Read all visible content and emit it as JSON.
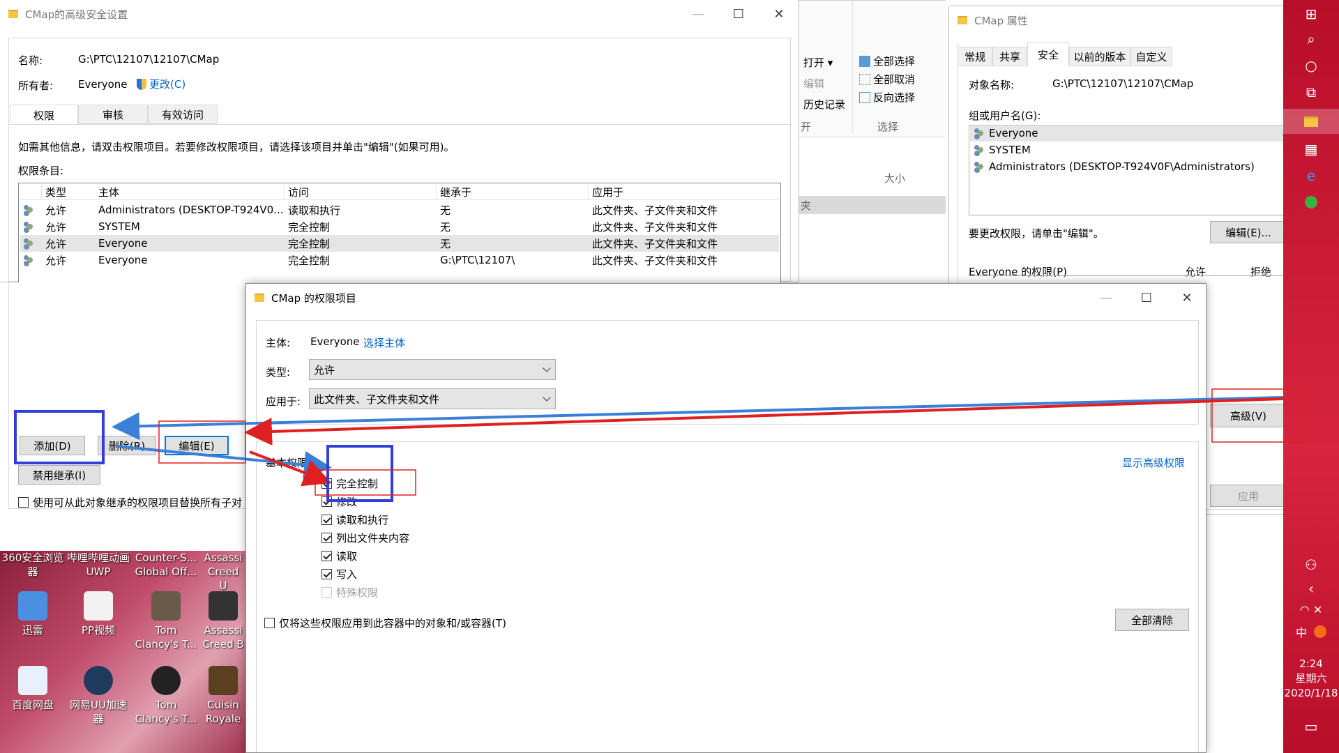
{
  "adv_window": {
    "title": "CMap的高级安全设置",
    "name_label": "名称:",
    "name_value": "G:\\PTC\\12107\\12107\\CMap",
    "owner_label": "所有者:",
    "owner_value": "Everyone",
    "change_link": "更改(C)",
    "tabs": [
      "权限",
      "审核",
      "有效访问"
    ],
    "info_text": "如需其他信息，请双击权限项目。若要修改权限项目，请选择该项目并单击\"编辑\"(如果可用)。",
    "entries_label": "权限条目:",
    "columns": [
      "类型",
      "主体",
      "访问",
      "继承于",
      "应用于"
    ],
    "rows": [
      [
        "允许",
        "Administrators (DESKTOP-T924V0...",
        "读取和执行",
        "无",
        "此文件夹、子文件夹和文件"
      ],
      [
        "允许",
        "SYSTEM",
        "完全控制",
        "无",
        "此文件夹、子文件夹和文件"
      ],
      [
        "允许",
        "Everyone",
        "完全控制",
        "无",
        "此文件夹、子文件夹和文件"
      ],
      [
        "允许",
        "Everyone",
        "完全控制",
        "G:\\PTC\\12107\\",
        "此文件夹、子文件夹和文件"
      ]
    ],
    "add_button": "添加(D)",
    "remove_button": "删除(R)",
    "edit_button": "编辑(E)",
    "disable_inherit_button": "禁用继承(I)",
    "replace_checkbox": "使用可从此对象继承的权限项目替换所有子对"
  },
  "explorer": {
    "open": "打开",
    "edit": "编辑",
    "history": "历史记录",
    "open_group": "开",
    "select_all": "全部选择",
    "select_none": "全部取消",
    "invert": "反向选择",
    "select_group": "选择",
    "size_col": "大小",
    "row_fragment": "夹"
  },
  "props_window": {
    "title": "CMap 属性",
    "tabs": [
      "常规",
      "共享",
      "安全",
      "以前的版本",
      "自定义"
    ],
    "object_label": "对象名称:",
    "object_value": "G:\\PTC\\12107\\12107\\CMap",
    "group_label": "组或用户名(G):",
    "users": [
      "Everyone",
      "SYSTEM",
      "Administrators (DESKTOP-T924V0F\\Administrators)"
    ],
    "change_hint": "要更改权限，请单击\"编辑\"。",
    "edit_button": "编辑(E)...",
    "perm_for": "Everyone 的权限(P)",
    "allow": "允许",
    "deny": "拒绝",
    "advanced_button": "高级(V)",
    "apply_button": "应用"
  },
  "entry_window": {
    "title": "CMap 的权限项目",
    "principal_label": "主体:",
    "principal_value": "Everyone",
    "select_principal": "选择主体",
    "type_label": "类型:",
    "type_value": "允许",
    "applies_label": "应用于:",
    "applies_value": "此文件夹、子文件夹和文件",
    "basic_label": "基本权限:",
    "show_advanced": "显示高级权限",
    "perms": [
      {
        "label": "完全控制",
        "checked": true,
        "disabled": false
      },
      {
        "label": "修改",
        "checked": true,
        "disabled": false
      },
      {
        "label": "读取和执行",
        "checked": true,
        "disabled": false
      },
      {
        "label": "列出文件夹内容",
        "checked": true,
        "disabled": false
      },
      {
        "label": "读取",
        "checked": true,
        "disabled": false
      },
      {
        "label": "写入",
        "checked": true,
        "disabled": false
      },
      {
        "label": "特殊权限",
        "checked": false,
        "disabled": true
      }
    ],
    "only_apply": "仅将这些权限应用到此容器中的对象和/或容器(T)",
    "clear_all": "全部清除"
  },
  "desktop": {
    "top_labels": [
      "360安全浏览器",
      "哔哩哔哩动画 UWP",
      "Counter-S... Global Off...",
      "Assassi Creed U"
    ],
    "icons_row1": [
      "迅雷",
      "PP视频",
      "Tom Clancy's T...",
      "Assassi Creed B"
    ],
    "icons_row2": [
      "百度网盘",
      "网易UU加速器",
      "Tom Clancy's T...",
      "Cuisin Royale"
    ]
  },
  "taskbar": {
    "time": "2:24",
    "weekday": "星期六",
    "date": "2020/1/18",
    "ime": "中"
  },
  "colors": {
    "taskbar": "#c8102e",
    "link": "#0066cc",
    "annotation_blue": "#2f3fd8",
    "annotation_red": "#e02020",
    "arrow_blue": "#3a7fd8"
  }
}
